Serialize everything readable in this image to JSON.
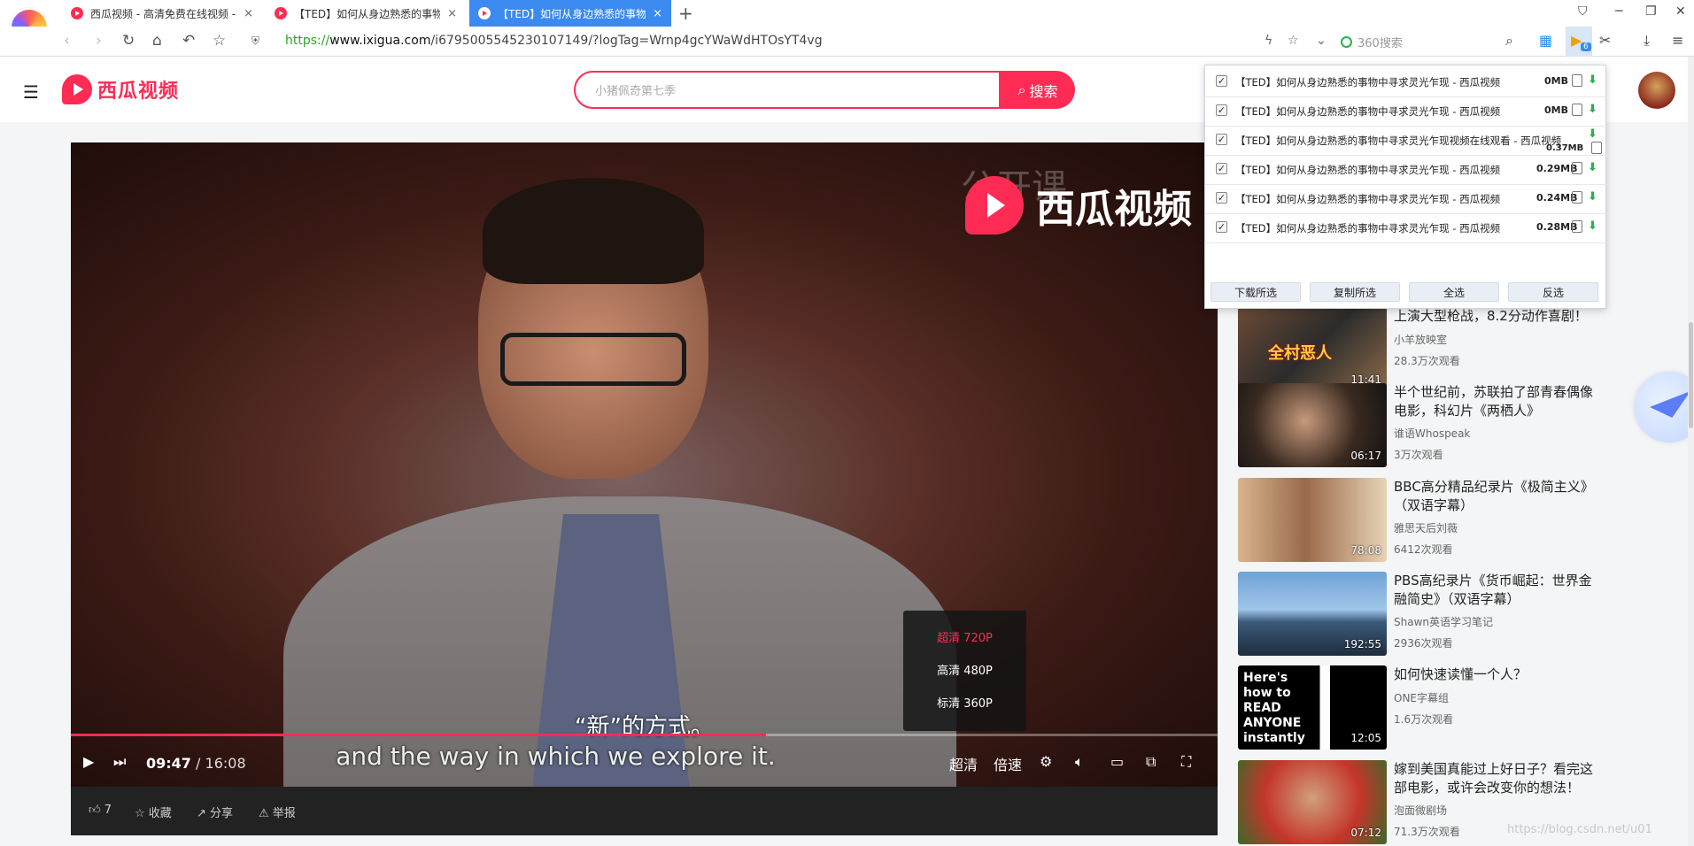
{
  "browser": {
    "tabs": [
      {
        "label": "西瓜视频 - 高清免费在线视频 -",
        "close": "×"
      },
      {
        "label": "【TED】如何从身边熟悉的事物",
        "close": "×"
      },
      {
        "label": "【TED】如何从身边熟悉的事物",
        "close": "×"
      }
    ],
    "new_tab": "+",
    "url_proto": "https://",
    "url_domain": "www.ixigua.com",
    "url_rest": "/i6795005545230107149/?logTag=Wrnp4gcYWaWdHTOsYT4vg",
    "search_engine_placeholder": "360搜索",
    "extension_badge": "6"
  },
  "site": {
    "logo_text": "西瓜视频",
    "search_placeholder": "小猪佩奇第七季",
    "search_button": "搜索"
  },
  "player": {
    "watermark": "西瓜视频",
    "watermark_faint": "公开课",
    "subtitle_zh": "“新”的方式。",
    "subtitle_en": "and the way in which we explore it.",
    "current_time": "09:47",
    "separator": "/",
    "total_time": "16:08",
    "progress_fraction": 0.606,
    "quality_button": "超清",
    "speed_button": "倍速",
    "quality_options": [
      {
        "label": "超清 720P",
        "selected": true
      },
      {
        "label": "高清 480P",
        "selected": false
      },
      {
        "label": "标清 360P",
        "selected": false
      }
    ],
    "accent_color": "#fe2c55"
  },
  "actions": {
    "like": "7",
    "collect": "收藏",
    "share": "分享",
    "report": "举报"
  },
  "download_popup": {
    "items": [
      {
        "title": "【TED】如何从身边熟悉的事物中寻求灵光乍现 - 西瓜视频",
        "size": "0MB",
        "checked": true
      },
      {
        "title": "【TED】如何从身边熟悉的事物中寻求灵光乍现 - 西瓜视频",
        "size": "0MB",
        "checked": true
      },
      {
        "title": "【TED】如何从身边熟悉的事物中寻求灵光乍现视频在线观看 - 西瓜视频",
        "size": "0.37MB",
        "checked": true
      },
      {
        "title": "【TED】如何从身边熟悉的事物中寻求灵光乍现 - 西瓜视频",
        "size": "0.29MB",
        "checked": true
      },
      {
        "title": "【TED】如何从身边熟悉的事物中寻求灵光乍现 - 西瓜视频",
        "size": "0.24MB",
        "checked": true
      },
      {
        "title": "【TED】如何从身边熟悉的事物中寻求灵光乍现 - 西瓜视频",
        "size": "0.28MB",
        "checked": true
      }
    ],
    "check_mark": "✓",
    "download_icon": "⬇",
    "buttons": [
      "下载所选",
      "复制所选",
      "全选",
      "反选"
    ]
  },
  "recommendations": [
    {
      "title": "上演大型枪战，8.2分动作喜剧！",
      "author": "小羊放映室",
      "views": "28.3万次观看",
      "duration": "11:41",
      "thumb_text": "全村恶人"
    },
    {
      "title": "半个世纪前，苏联拍了部青春偶像电影，科幻片《两栖人》",
      "author": "谁语Whospeak",
      "views": "3万次观看",
      "duration": "06:17",
      "thumb_text": ""
    },
    {
      "title": "BBC高分精品纪录片《极简主义》（双语字幕）",
      "author": "雅思天后刘薇",
      "views": "6412次观看",
      "duration": "78:08",
      "thumb_text": ""
    },
    {
      "title": "PBS高纪录片《货币崛起：世界金融简史》（双语字幕）",
      "author": "Shawn英语学习笔记",
      "views": "2936次观看",
      "duration": "192:55",
      "thumb_text": ""
    },
    {
      "title": "如何快速读懂一个人？",
      "author": "ONE字幕组",
      "views": "1.6万次观看",
      "duration": "12:05",
      "thumb_text": "Here's how to READ ANYONE instantly"
    },
    {
      "title": "嫁到美国真能过上好日子？看完这部电影，或许会改变你的想法！",
      "author": "泡面微剧场",
      "views": "71.3万次观看",
      "duration": "07:12",
      "thumb_text": ""
    }
  ],
  "watermark_csdn": "https://blog.csdn.net/u01",
  "icons": [
    "menu-icon",
    "back-icon",
    "forward-icon",
    "refresh-icon",
    "home-icon",
    "undo-icon",
    "star-icon",
    "play-icon",
    "next-icon",
    "settings-icon",
    "volume-icon",
    "fullscreen-icon",
    "thumbs-up-icon",
    "share-icon",
    "warning-icon",
    "search-icon"
  ]
}
